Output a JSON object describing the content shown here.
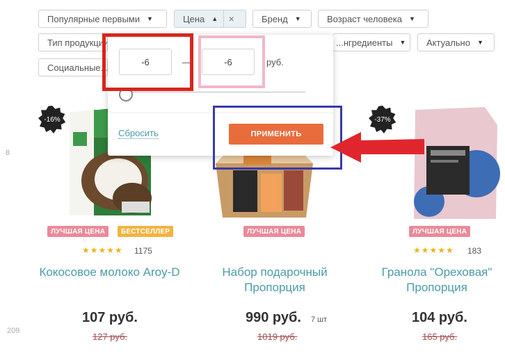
{
  "filters": {
    "popular": "Популярные первыми",
    "price": "Цена",
    "brand": "Бренд",
    "age": "Возраст человека",
    "product_type": "Тип продукции",
    "ingredients": "...нгредиенты",
    "actual": "Актуально",
    "social": "Социальные..."
  },
  "price_popup": {
    "min_value": "-6",
    "max_value": "-6",
    "dash": "—",
    "unit": "руб.",
    "reset": "Сбросить",
    "apply": "ПРИМЕНИТЬ"
  },
  "side_numbers": [
    "8",
    "209"
  ],
  "products": [
    {
      "discount": "-16%",
      "tags": [
        "ЛУЧШАЯ ЦЕНА",
        "БЕСТСЕЛЛЕР"
      ],
      "stars": "★★★★★",
      "reviews": "1175",
      "name": "Кокосовое молоко Aroy-D",
      "price": "107 руб.",
      "old_price": "127 руб."
    },
    {
      "tags": [
        "ЛУЧШАЯ ЦЕНА"
      ],
      "name": "Набор подарочный Пропорция",
      "price": "990 руб.",
      "qty": "7 шт",
      "old_price": "1019 руб."
    },
    {
      "discount": "-37%",
      "tags": [
        "ЛУЧШАЯ ЦЕНА"
      ],
      "stars": "★★★★★",
      "reviews": "183",
      "name": "Гранола \"Ореховая\" Пропорция",
      "price": "104 руб.",
      "old_price": "165 руб."
    }
  ],
  "colors": {
    "accent": "#4a9aa8",
    "apply_button": "#e96d3c",
    "annotation_red": "#d9251c",
    "annotation_pink": "#f1b7c8",
    "annotation_blue": "#3a3aa8"
  }
}
